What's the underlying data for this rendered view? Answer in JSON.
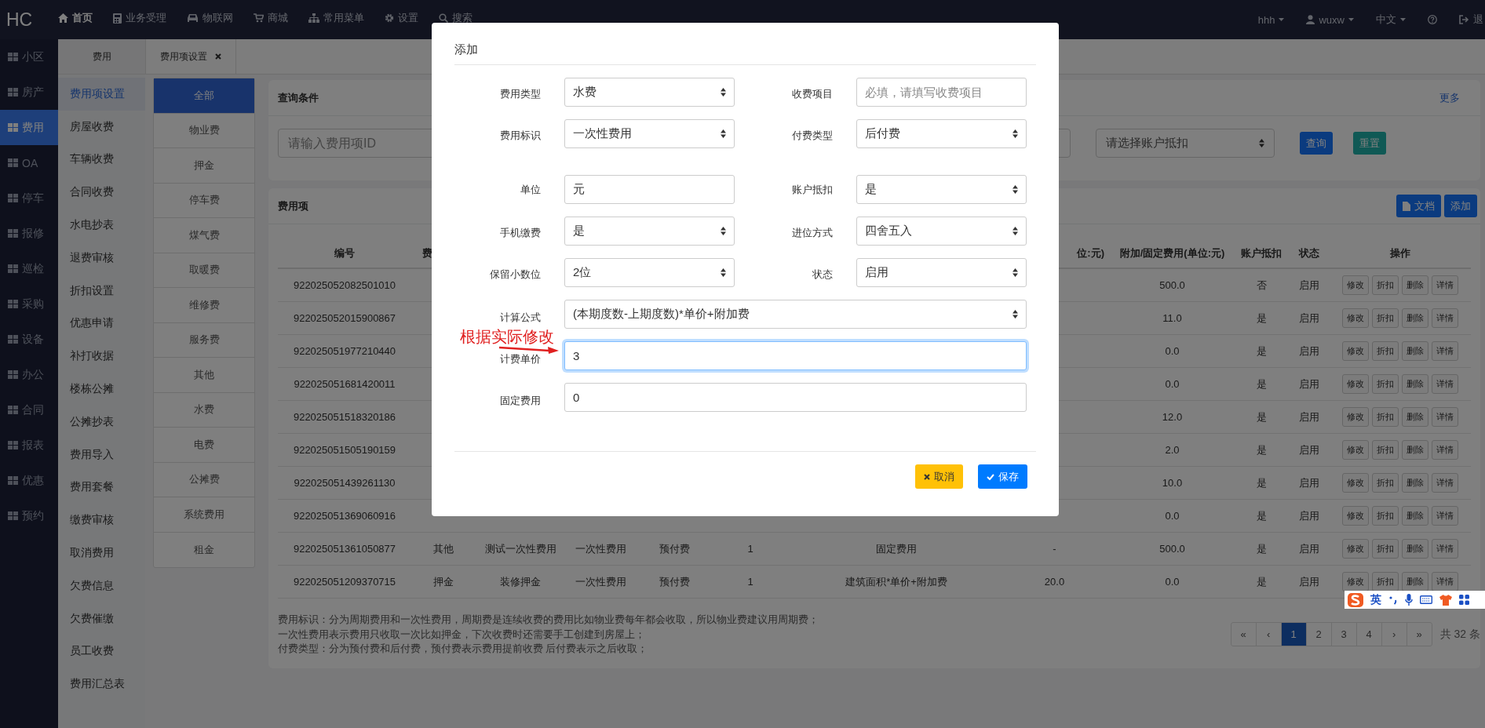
{
  "topbar": {
    "logo": "HC",
    "nav": [
      {
        "label": "首页",
        "selected": true
      },
      {
        "label": "业务受理",
        "selected": false
      },
      {
        "label": "物联网",
        "selected": false
      },
      {
        "label": "商城",
        "selected": false
      },
      {
        "label": "常用菜单",
        "selected": false
      },
      {
        "label": "设置",
        "selected": false
      },
      {
        "label": "搜索",
        "selected": false
      }
    ],
    "right": [
      {
        "kind": "dropdown",
        "label": "hhh"
      },
      {
        "kind": "user",
        "label": "wuxw"
      },
      {
        "kind": "dropdown",
        "label": "中文"
      },
      {
        "kind": "help"
      },
      {
        "kind": "logout",
        "label": "退"
      }
    ]
  },
  "sidebar": {
    "items": [
      {
        "label": "小区",
        "selected": false
      },
      {
        "label": "房产",
        "selected": false
      },
      {
        "label": "费用",
        "selected": true
      },
      {
        "label": "OA",
        "selected": false
      },
      {
        "label": "停车",
        "selected": false
      },
      {
        "label": "报修",
        "selected": false
      },
      {
        "label": "巡检",
        "selected": false
      },
      {
        "label": "采购",
        "selected": false
      },
      {
        "label": "设备",
        "selected": false
      },
      {
        "label": "办公",
        "selected": false
      },
      {
        "label": "合同",
        "selected": false
      },
      {
        "label": "报表",
        "selected": false
      },
      {
        "label": "优惠",
        "selected": false
      },
      {
        "label": "预约",
        "selected": false
      }
    ]
  },
  "tabs": [
    {
      "label": "费用",
      "closable": false
    },
    {
      "label": "费用项设置",
      "closable": true
    }
  ],
  "submenu": {
    "items": [
      {
        "label": "费用项设置",
        "selected": true
      },
      {
        "label": "房屋收费",
        "selected": false
      },
      {
        "label": "车辆收费",
        "selected": false
      },
      {
        "label": "合同收费",
        "selected": false
      },
      {
        "label": "水电抄表",
        "selected": false
      },
      {
        "label": "退费审核",
        "selected": false
      },
      {
        "label": "折扣设置",
        "selected": false
      },
      {
        "label": "优惠申请",
        "selected": false
      },
      {
        "label": "补打收据",
        "selected": false
      },
      {
        "label": "楼栋公摊",
        "selected": false
      },
      {
        "label": "公摊抄表",
        "selected": false
      },
      {
        "label": "费用导入",
        "selected": false
      },
      {
        "label": "费用套餐",
        "selected": false
      },
      {
        "label": "缴费审核",
        "selected": false
      },
      {
        "label": "取消费用",
        "selected": false
      },
      {
        "label": "欠费信息",
        "selected": false
      },
      {
        "label": "欠费催缴",
        "selected": false
      },
      {
        "label": "员工收费",
        "selected": false
      },
      {
        "label": "费用汇总表",
        "selected": false
      }
    ]
  },
  "categories": [
    {
      "label": "全部",
      "selected": true
    },
    {
      "label": "物业费",
      "selected": false
    },
    {
      "label": "押金",
      "selected": false
    },
    {
      "label": "停车费",
      "selected": false
    },
    {
      "label": "煤气费",
      "selected": false
    },
    {
      "label": "取暖费",
      "selected": false
    },
    {
      "label": "维修费",
      "selected": false
    },
    {
      "label": "服务费",
      "selected": false
    },
    {
      "label": "其他",
      "selected": false
    },
    {
      "label": "水费",
      "selected": false
    },
    {
      "label": "电费",
      "selected": false
    },
    {
      "label": "公摊费",
      "selected": false
    },
    {
      "label": "系统费用",
      "selected": false
    },
    {
      "label": "租金",
      "selected": false
    }
  ],
  "query": {
    "title": "查询条件",
    "more": "更多",
    "id_field": {
      "placeholder": "请输入费用项ID"
    },
    "deduct_select": {
      "placeholder": "请选择账户抵扣"
    },
    "buttons": [
      {
        "kind": "primary",
        "label": "查询"
      },
      {
        "kind": "reset",
        "label": "重置"
      }
    ]
  },
  "fee_items": {
    "title": "费用项",
    "buttons": [
      {
        "kind": "doc",
        "label": "文档"
      },
      {
        "kind": "add",
        "label": "添加"
      }
    ],
    "columns": [
      "编号",
      "费",
      "位:元)",
      "附加/固定费用(单位:元)",
      "账户抵扣",
      "状态",
      "操作"
    ],
    "rows": [
      {
        "id": "922025052082501010",
        "fixed_fee": "500.0",
        "account_deduct": "否",
        "status": "启用",
        "actions": [
          "修改",
          "折扣",
          "删除",
          "详情"
        ]
      },
      {
        "id": "922025052015900867",
        "fixed_fee": "11.0",
        "account_deduct": "是",
        "status": "启用",
        "actions": [
          "修改",
          "折扣",
          "删除",
          "详情"
        ]
      },
      {
        "id": "922025051977210440",
        "fixed_fee": "0.0",
        "account_deduct": "是",
        "status": "启用",
        "actions": [
          "修改",
          "折扣",
          "删除",
          "详情"
        ]
      },
      {
        "id": "922025051681420011",
        "fixed_fee": "0.0",
        "account_deduct": "是",
        "status": "启用",
        "actions": [
          "修改",
          "折扣",
          "删除",
          "详情"
        ]
      },
      {
        "id": "922025051518320186",
        "fixed_fee": "12.0",
        "account_deduct": "是",
        "status": "启用",
        "actions": [
          "修改",
          "折扣",
          "删除",
          "详情"
        ]
      },
      {
        "id": "922025051505190159",
        "fixed_fee": "2.0",
        "account_deduct": "是",
        "status": "启用",
        "actions": [
          "修改",
          "折扣",
          "删除",
          "详情"
        ]
      },
      {
        "id": "922025051439261130",
        "fixed_fee": "10.0",
        "account_deduct": "是",
        "status": "启用",
        "actions": [
          "修改",
          "折扣",
          "删除",
          "详情"
        ]
      },
      {
        "id": "922025051369060916",
        "fixed_fee": "0.0",
        "account_deduct": "是",
        "status": "启用",
        "actions": [
          "修改",
          "折扣",
          "删除",
          "详情"
        ]
      },
      {
        "id": "922025051361050877",
        "column_2": "其他",
        "column_3": "测试一次性费用",
        "column_4": "一次性费用",
        "column_5": "预付费",
        "column_6": "1",
        "column_7": "固定费用",
        "column_8": "-",
        "fixed_fee": "500.0",
        "account_deduct": "是",
        "status": "启用",
        "actions": [
          "修改",
          "折扣",
          "删除",
          "详情"
        ]
      },
      {
        "id": "922025051209370715",
        "column_2": "押金",
        "column_3": "装修押金",
        "column_4": "一次性费用",
        "column_5": "预付费",
        "column_6": "1",
        "column_7": "建筑面积*单价+附加费",
        "column_8": "20.0",
        "fixed_fee": "0.0",
        "account_deduct": "是",
        "status": "启用",
        "actions": [
          "修改",
          "折扣",
          "删除",
          "详情"
        ]
      }
    ],
    "notes": [
      "费用标识：分为周期费用和一次性费用，周期费是连续收费的费用比如物业费每年都会收取，所以物业费建议用周期费；",
      "一次性费用表示费用只收取一次比如押金，下次收费时还需要手工创建到房屋上；",
      "付费类型：分为预付费和后付费，预付费表示费用提前收费 后付费表示之后收取；"
    ],
    "pagination": {
      "pages": [
        {
          "label": "«",
          "selected": false
        },
        {
          "label": "‹",
          "selected": false
        },
        {
          "label": "1",
          "selected": true
        },
        {
          "label": "2",
          "selected": false
        },
        {
          "label": "3",
          "selected": false
        },
        {
          "label": "4",
          "selected": false
        },
        {
          "label": "›",
          "selected": false
        },
        {
          "label": "»",
          "selected": false
        }
      ],
      "total": "共 32 条"
    }
  },
  "modal": {
    "title": "添加",
    "fields": [
      {
        "label": "费用类型",
        "kind": "select",
        "value": "水费",
        "wide": false,
        "focused": false
      },
      {
        "label": "收费项目",
        "kind": "input",
        "placeholder": "必填，请填写收费项目",
        "wide": false,
        "focused": false
      },
      {
        "label": "费用标识",
        "kind": "select",
        "value": "一次性费用",
        "wide": false,
        "focused": false
      },
      {
        "label": "付费类型",
        "kind": "select",
        "value": "后付费",
        "wide": false,
        "focused": false
      },
      {
        "label": "单位",
        "kind": "input",
        "value": "元",
        "wide": false,
        "focused": false
      },
      {
        "label": "账户抵扣",
        "kind": "select",
        "value": "是",
        "wide": false,
        "focused": false
      },
      {
        "label": "手机缴费",
        "kind": "select",
        "value": "是",
        "wide": false,
        "focused": false
      },
      {
        "label": "进位方式",
        "kind": "select",
        "value": "四舍五入",
        "wide": false,
        "focused": false
      },
      {
        "label": "保留小数位",
        "kind": "select",
        "value": "2位",
        "wide": false,
        "focused": false
      },
      {
        "label": "状态",
        "kind": "select",
        "value": "启用",
        "wide": false,
        "focused": false
      },
      {
        "label": "计算公式",
        "kind": "select",
        "value": "(本期度数-上期度数)*单价+附加费",
        "wide": true,
        "focused": false
      },
      {
        "label": "计费单价",
        "kind": "input",
        "value": "3",
        "wide": true,
        "focused": true
      },
      {
        "label": "固定费用",
        "kind": "input",
        "value": "0",
        "wide": true,
        "focused": false
      }
    ],
    "buttons": [
      {
        "kind": "cancel",
        "label": "取消"
      },
      {
        "kind": "save",
        "label": "保存"
      }
    ]
  },
  "annotation": {
    "text": "根据实际修改"
  },
  "ime_toolbar": {
    "mode": "英"
  }
}
